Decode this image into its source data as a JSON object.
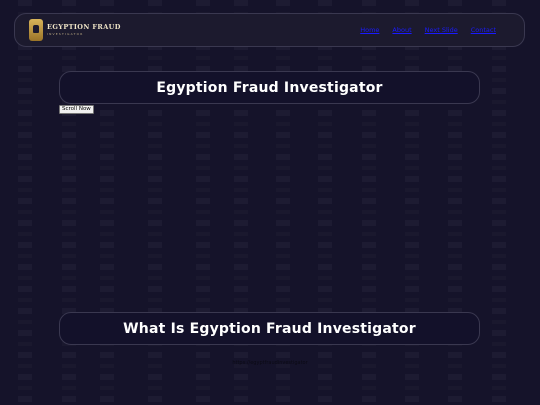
{
  "logo": {
    "title": "EGYPTION FRAUD",
    "subtitle": "INVESTIGATOR",
    "icon": "pharaoh-mask-icon"
  },
  "nav": {
    "items": [
      {
        "label": "Home"
      },
      {
        "label": "About"
      },
      {
        "label": "Next Slide"
      },
      {
        "label": "Contact"
      }
    ]
  },
  "hero": {
    "title": "Egyption Fraud Investigator",
    "scroll_button": "Scroll Now"
  },
  "section": {
    "title": "What Is Egyption Fraud Investigator"
  },
  "image": {
    "broken_alt": "https://egyptfraudinvestigator"
  },
  "colors": {
    "background": "#15132a",
    "panel_border": "#3a3850",
    "link": "#1a1aff",
    "logo_gold": "#d8b45a"
  }
}
